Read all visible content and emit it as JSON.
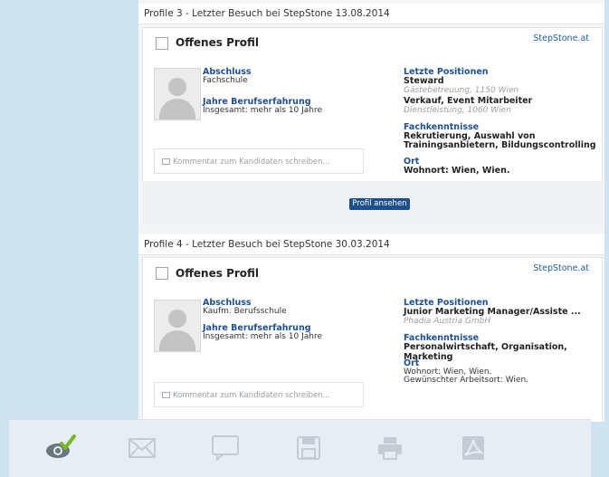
{
  "profiles": [
    {
      "header": "Profile 3 - Letzter Besuch bei StepStone 13.08.2014",
      "title": "Offenes Profil",
      "source": "StepStone.at",
      "abschluss_label": "Abschluss",
      "abschluss_value": "Fachschule",
      "jahre_label": "Jahre Berufserfahrung",
      "jahre_value": "Insgesamt: mehr als 10 Jahre",
      "positions_label": "Letzte Positionen",
      "positions": [
        {
          "title": "Steward",
          "detail": "Gästebetreuung, 1150 Wien"
        },
        {
          "title": "Verkauf, Event Mitarbeiter",
          "detail": "Dienstleistung, 1060 Wien"
        }
      ],
      "skills_label": "Fachkenntnisse",
      "skills_lines": [
        "Rekrutierung, Auswahl von",
        "Trainingsanbietern, Bildungscontrolling"
      ],
      "ort_label": "Ort",
      "ort_lines": [
        "Wohnort: Wien, Wien."
      ],
      "comment_placeholder": "Kommentar zum Kandidaten schreiben...",
      "view_button": "Profil ansehen"
    },
    {
      "header": "Profile 4 - Letzter Besuch bei StepStone 30.03.2014",
      "title": "Offenes Profil",
      "source": "StepStone.at",
      "abschluss_label": "Abschluss",
      "abschluss_value": "Kaufm. Berufsschule",
      "jahre_label": "Jahre Berufserfahrung",
      "jahre_value": "Insgesamt: mehr als 10 Jahre",
      "positions_label": "Letzte Positionen",
      "positions": [
        {
          "title": "Junior Marketing Manager/Assiste ...",
          "detail": "Phadia Austria GmbH"
        }
      ],
      "skills_label": "Fachkenntnisse",
      "skills_lines": [
        "Personalwirtschaft, Organisation, Marketing"
      ],
      "ort_label": "Ort",
      "ort_lines": [
        "Wohnort: Wien, Wien.",
        "Gewünschter Arbeitsort: Wien."
      ],
      "comment_placeholder": "Kommentar zum Kandidaten schreiben..."
    }
  ],
  "toolbar": {
    "icons": [
      "eye-check-icon",
      "mail-icon",
      "comment-icon",
      "save-icon",
      "print-icon",
      "pdf-icon"
    ],
    "accent_color": "#7ab52a",
    "icon_color": "#c3ccd4",
    "eye_color": "#6a7580"
  }
}
